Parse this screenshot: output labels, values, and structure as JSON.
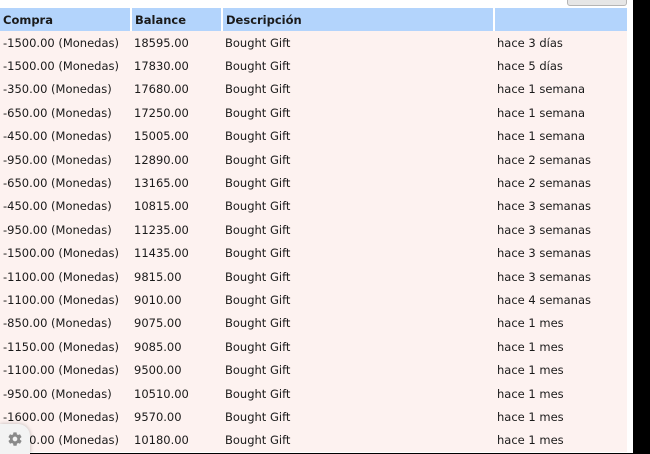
{
  "table": {
    "headers": [
      "Compra",
      "Balance",
      "Descripción",
      ""
    ],
    "rows": [
      {
        "purchase": "-1500.00 (Monedas)",
        "balance": "18595.00",
        "description": "Bought Gift",
        "time": "hace 3 días"
      },
      {
        "purchase": "-1500.00 (Monedas)",
        "balance": "17830.00",
        "description": "Bought Gift",
        "time": "hace 5 días"
      },
      {
        "purchase": "-350.00 (Monedas)",
        "balance": "17680.00",
        "description": "Bought Gift",
        "time": "hace 1 semana"
      },
      {
        "purchase": "-650.00 (Monedas)",
        "balance": "17250.00",
        "description": "Bought Gift",
        "time": "hace 1 semana"
      },
      {
        "purchase": "-450.00 (Monedas)",
        "balance": "15005.00",
        "description": "Bought Gift",
        "time": "hace 1 semana"
      },
      {
        "purchase": "-950.00 (Monedas)",
        "balance": "12890.00",
        "description": "Bought Gift",
        "time": "hace 2 semanas"
      },
      {
        "purchase": "-650.00 (Monedas)",
        "balance": "13165.00",
        "description": "Bought Gift",
        "time": "hace 2 semanas"
      },
      {
        "purchase": "-450.00 (Monedas)",
        "balance": "10815.00",
        "description": "Bought Gift",
        "time": "hace 3 semanas"
      },
      {
        "purchase": "-950.00 (Monedas)",
        "balance": "11235.00",
        "description": "Bought Gift",
        "time": "hace 3 semanas"
      },
      {
        "purchase": "-1500.00 (Monedas)",
        "balance": "11435.00",
        "description": "Bought Gift",
        "time": "hace 3 semanas"
      },
      {
        "purchase": "-1100.00 (Monedas)",
        "balance": "9815.00",
        "description": "Bought Gift",
        "time": "hace 3 semanas"
      },
      {
        "purchase": "-1100.00 (Monedas)",
        "balance": "9010.00",
        "description": "Bought Gift",
        "time": "hace 4 semanas"
      },
      {
        "purchase": "-850.00 (Monedas)",
        "balance": "9075.00",
        "description": "Bought Gift",
        "time": "hace 1 mes"
      },
      {
        "purchase": "-1150.00 (Monedas)",
        "balance": "9085.00",
        "description": "Bought Gift",
        "time": "hace 1 mes"
      },
      {
        "purchase": "-1100.00 (Monedas)",
        "balance": "9500.00",
        "description": "Bought Gift",
        "time": "hace 1 mes"
      },
      {
        "purchase": "-950.00 (Monedas)",
        "balance": "10510.00",
        "description": "Bought Gift",
        "time": "hace 1 mes"
      },
      {
        "purchase": "-1600.00 (Monedas)",
        "balance": "9570.00",
        "description": "Bought Gift",
        "time": "hace 1 mes"
      },
      {
        "purchase": "-1100.00 (Monedas)",
        "balance": "10180.00",
        "description": "Bought Gift",
        "time": "hace 1 mes"
      }
    ]
  },
  "settings_icon": "gear-icon",
  "colors": {
    "header_bg": "#b3d4fc",
    "row_bg": "#fdf2f0",
    "outer_bg": "#000000"
  }
}
